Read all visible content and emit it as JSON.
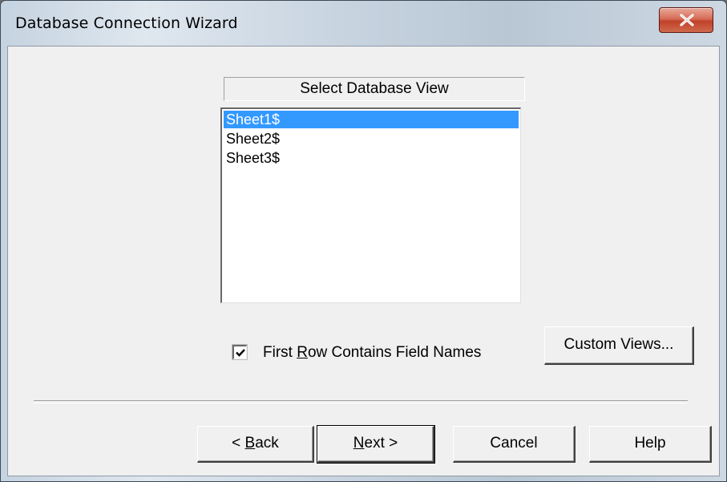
{
  "window": {
    "title": "Database Connection Wizard",
    "close_glyph": "X"
  },
  "view_list": {
    "header": "Select Database View",
    "items": [
      "Sheet1$",
      "Sheet2$",
      "Sheet3$"
    ],
    "selected_index": 0
  },
  "options": {
    "first_row_checkbox": {
      "checked": true,
      "label_before": "First ",
      "label_mnemonic": "R",
      "label_after": "ow Contains Field Names"
    },
    "custom_views_label": "Custom Views..."
  },
  "footer": {
    "back": {
      "prefix": "< ",
      "mnemonic": "B",
      "rest": "ack"
    },
    "next": {
      "mnemonic": "N",
      "rest": "ext >"
    },
    "cancel": "Cancel",
    "help": "Help"
  },
  "colors": {
    "selection": "#3399ff",
    "close_button": "#c1412a",
    "dialog_face": "#f0f0f0"
  }
}
